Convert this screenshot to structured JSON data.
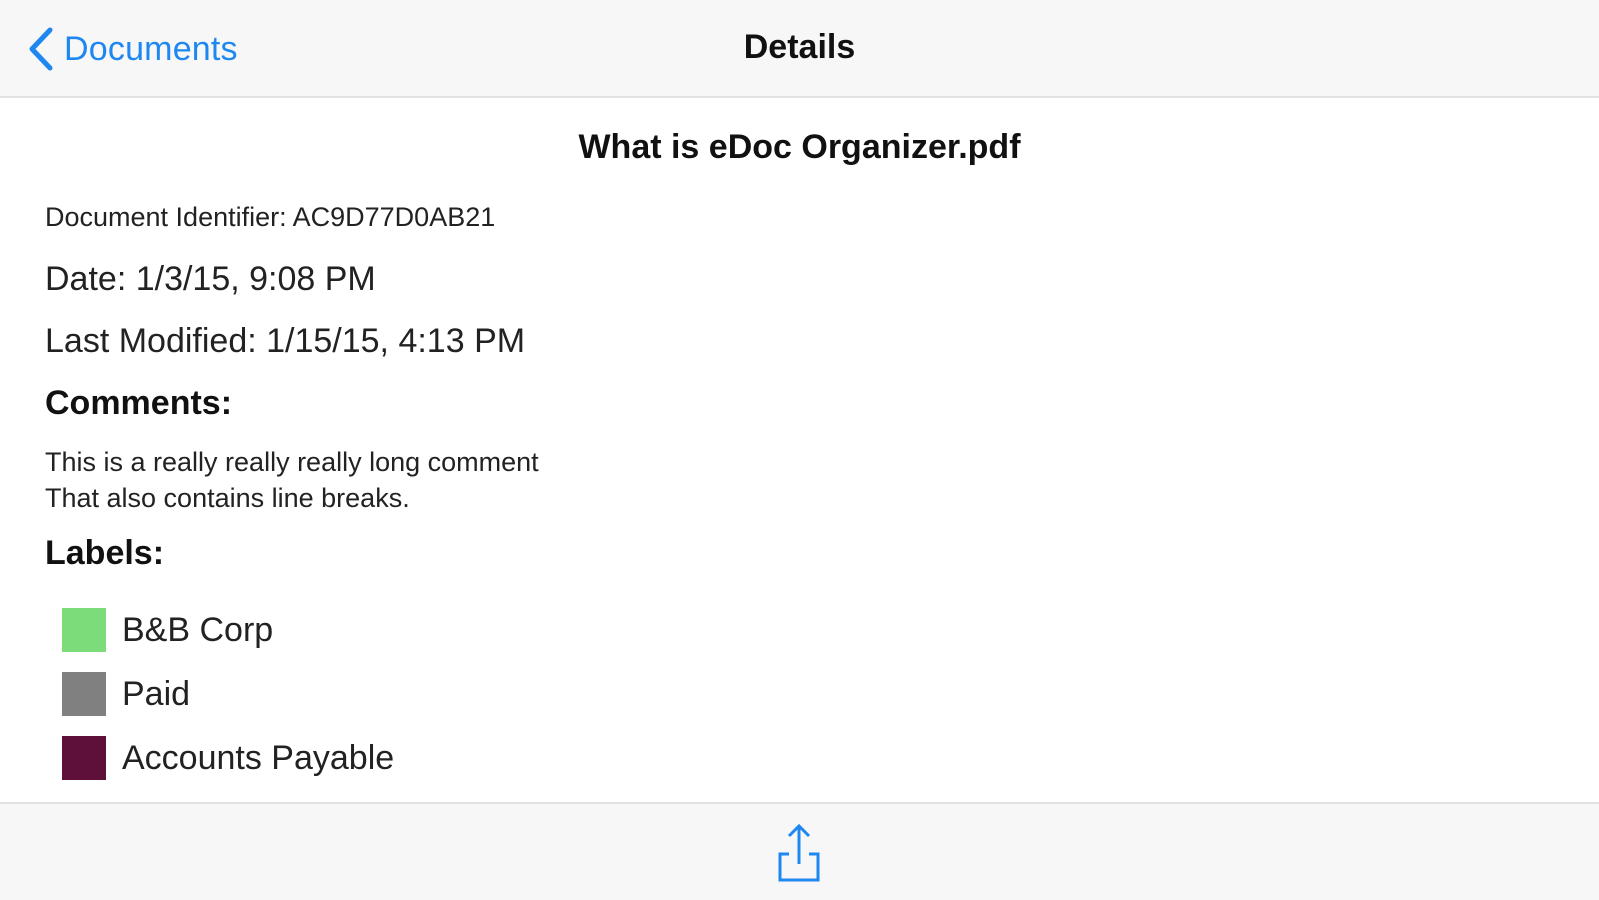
{
  "navbar": {
    "back_label": "Documents",
    "title": "Details",
    "back_icon": "chevron-left-icon"
  },
  "document": {
    "title": "What is eDoc Organizer.pdf",
    "identifier_line": "Document Identifier: AC9D77D0AB21",
    "date_line": "Date: 1/3/15, 9:08 PM",
    "modified_line": "Last Modified: 1/15/15, 4:13 PM",
    "comments_heading": "Comments:",
    "comment_lines": [
      "This is a really really really long comment",
      "That also contains line breaks."
    ],
    "labels_heading": "Labels:",
    "labels": [
      {
        "name": "B&B Corp",
        "color": "#7ddc7a"
      },
      {
        "name": "Paid",
        "color": "#808080"
      },
      {
        "name": "Accounts Payable",
        "color": "#5e0f3a"
      }
    ]
  },
  "toolbar": {
    "share_icon": "share-icon"
  },
  "colors": {
    "accent": "#1e88f0",
    "bar_background": "#f7f7f7"
  }
}
